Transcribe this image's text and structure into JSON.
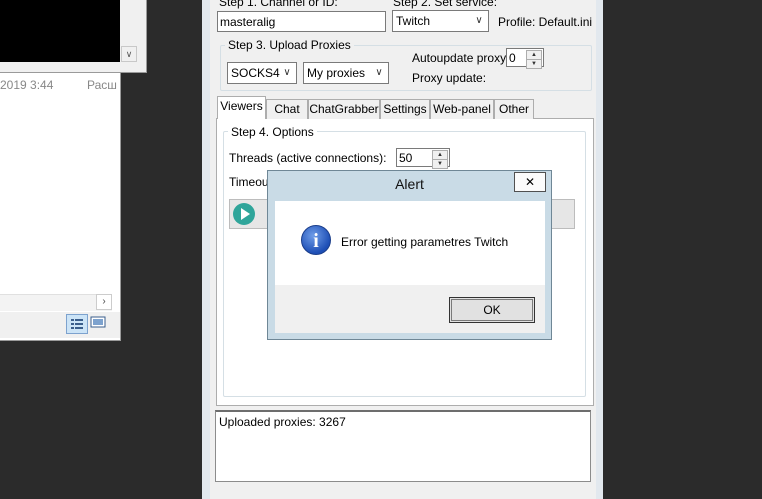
{
  "background_window": {
    "date_text": "2019 3:44",
    "column_text": "Расш"
  },
  "step1": {
    "label": "Step 1. Channel or ID:",
    "value": "masteralig"
  },
  "step2": {
    "label": "Step 2. Set service:",
    "selected": "Twitch",
    "profile_text": "Profile: Default.ini"
  },
  "step3": {
    "title": "Step 3. Upload Proxies",
    "proxy_type": "SOCKS4",
    "proxy_source": "My proxies",
    "autoupdate_label": "Autoupdate proxy:",
    "autoupdate_value": "0",
    "proxy_update_label": "Proxy update:"
  },
  "tabs": [
    "Viewers",
    "Chat",
    "ChatGrabber",
    "Settings",
    "Web-panel",
    "Other"
  ],
  "step4": {
    "title": "Step 4. Options",
    "threads_label": "Threads (active connections):",
    "threads_value": "50",
    "timeout_label": "Timeout"
  },
  "log": {
    "line1": "Uploaded proxies: 3267"
  },
  "alert": {
    "title": "Alert",
    "close_glyph": "✕",
    "message": "Error getting parametres Twitch",
    "ok_label": "OK"
  },
  "icons": {
    "info": "info-icon",
    "play": "play-icon",
    "dropdown": "chevron-down-icon"
  },
  "colors": {
    "accent_play": "#2fa59a",
    "info_blue": "#1d4eb5"
  }
}
